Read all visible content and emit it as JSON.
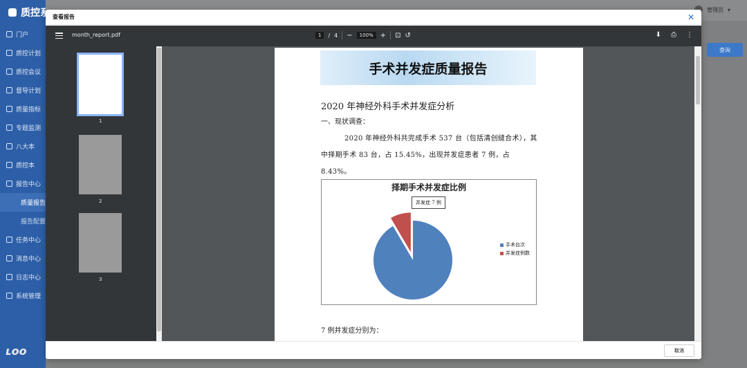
{
  "app": {
    "brand": "质控系统",
    "user": "管理员",
    "query_button": "查询",
    "sidebar": {
      "items": [
        {
          "label": "门户"
        },
        {
          "label": "质控计划"
        },
        {
          "label": "质控会议"
        },
        {
          "label": "督导计划"
        },
        {
          "label": "质量指标"
        },
        {
          "label": "专题监测"
        },
        {
          "label": "八大本"
        },
        {
          "label": "质控本"
        },
        {
          "label": "报告中心"
        }
      ],
      "sub_items": [
        {
          "label": "质量报告",
          "active": true
        },
        {
          "label": "报告配置",
          "active": false
        }
      ],
      "items_after": [
        {
          "label": "任务中心"
        },
        {
          "label": "消息中心"
        },
        {
          "label": "日志中心"
        },
        {
          "label": "系统管理"
        }
      ]
    }
  },
  "modal": {
    "title": "查看报告",
    "close_icon": "close-icon",
    "cancel_label": "取消"
  },
  "viewer": {
    "file_name": "month_report.pdf",
    "current_page": "1",
    "page_sep": "/",
    "total_pages": "4",
    "zoom": "100%",
    "thumbnails": [
      {
        "number": "1",
        "selected": true
      },
      {
        "number": "2",
        "selected": false
      },
      {
        "number": "3",
        "selected": false
      }
    ]
  },
  "page": {
    "banner_title": "手术并发症质量报告",
    "heading": "2020 年神经外科手术并发症分析",
    "section": "一、现状调查：",
    "paragraph": "2020 年神经外科共完成手术 537 台（包括清创缝合术），其中择期手术 83 台，占 15.45%，出现并发症患者 7 例，占 8.43%。",
    "tail": "7 例并发症分别为："
  },
  "chart_data": {
    "type": "pie",
    "title": "择期手术并发症比例",
    "categories": [
      "手术台次",
      "并发症例数"
    ],
    "values": [
      76,
      7
    ],
    "colors": [
      "#4f81bd",
      "#c0504d"
    ],
    "annotation": "并发症 7 例",
    "legend": "right"
  }
}
